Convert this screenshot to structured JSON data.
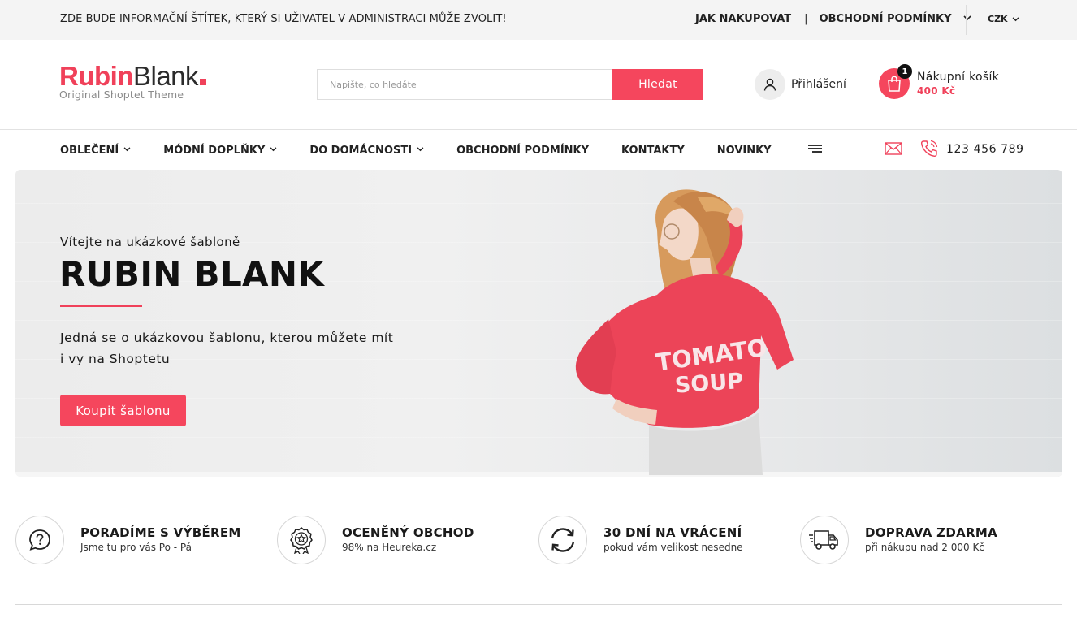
{
  "topbar": {
    "info_text": "ZDE BUDE INFORMAČNÍ ŠTÍTEK, KTERÝ SI UŽIVATEL V ADMINISTRACI MŮŽE ZVOLIT!",
    "links": [
      "JAK NAKUPOVAT",
      "OBCHODNÍ PODMÍNKY"
    ],
    "separator": "|",
    "currency": "CZK"
  },
  "header": {
    "logo_part1": "Rubin",
    "logo_part2": "Blank",
    "logo_tagline": "Original Shoptet Theme",
    "search_placeholder": "Napište, co hledáte",
    "search_button": "Hledat",
    "login_label": "Přihlášení",
    "cart_count": "1",
    "cart_label": "Nákupní košík",
    "cart_price": "400 Kč"
  },
  "nav": {
    "items": [
      {
        "label": "OBLEČENÍ",
        "dropdown": true
      },
      {
        "label": "MÓDNÍ DOPLŇKY",
        "dropdown": true
      },
      {
        "label": "DO DOMÁCNOSTI",
        "dropdown": true
      },
      {
        "label": "OBCHODNÍ PODMÍNKY",
        "dropdown": false
      },
      {
        "label": "KONTAKTY",
        "dropdown": false
      },
      {
        "label": "NOVINKY",
        "dropdown": false
      }
    ],
    "phone": "123 456 789"
  },
  "hero": {
    "welcome": "Vítejte na ukázkové šabloně",
    "title": "RUBIN BLANK",
    "description": "Jedná se o ukázkovou šablonu, kterou můžete mít i vy na Shoptetu",
    "cta": "Koupit šablonu",
    "shirt_text_line1": "TOMATO",
    "shirt_text_line2": "SOUP"
  },
  "features": [
    {
      "icon": "question-chat-icon",
      "title": "PORADÍME S VÝBĚREM",
      "subtitle": "Jsme tu pro vás Po - Pá"
    },
    {
      "icon": "award-badge-icon",
      "title": "OCENĚNÝ OBCHOD",
      "subtitle": "98% na Heureka.cz"
    },
    {
      "icon": "refresh-arrows-icon",
      "title": "30 DNÍ NA VRÁCENÍ",
      "subtitle": "pokud vám velikost nesedne"
    },
    {
      "icon": "delivery-truck-icon",
      "title": "DOPRAVA ZDARMA",
      "subtitle": "při nákupu nad 2 000 Kč"
    }
  ],
  "colors": {
    "accent": "#f5465d",
    "text": "#1a1a1a",
    "topbar_bg": "#f4f4f4"
  }
}
